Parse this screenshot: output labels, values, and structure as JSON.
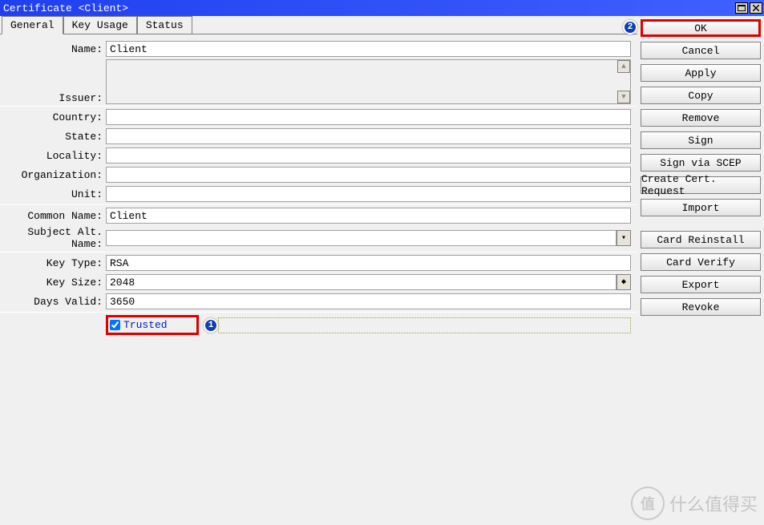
{
  "window": {
    "title": "Certificate <Client>"
  },
  "tabs": {
    "general": "General",
    "key_usage": "Key Usage",
    "status": "Status"
  },
  "labels": {
    "name": "Name:",
    "issuer": "Issuer:",
    "country": "Country:",
    "state": "State:",
    "locality": "Locality:",
    "organization": "Organization:",
    "unit": "Unit:",
    "common_name": "Common Name:",
    "subject_alt_name": "Subject Alt. Name:",
    "key_type": "Key Type:",
    "key_size": "Key Size:",
    "days_valid": "Days Valid:"
  },
  "values": {
    "name": "Client",
    "issuer": "",
    "country": "",
    "state": "",
    "locality": "",
    "organization": "",
    "unit": "",
    "common_name": "Client",
    "subject_alt_name": "",
    "key_type": "RSA",
    "key_size": "2048",
    "days_valid": "3650"
  },
  "trusted": {
    "label": "Trusted",
    "checked": true
  },
  "buttons": {
    "ok": "OK",
    "cancel": "Cancel",
    "apply": "Apply",
    "copy": "Copy",
    "remove": "Remove",
    "sign": "Sign",
    "sign_scep": "Sign via SCEP",
    "create_req": "Create Cert. Request",
    "import": "Import",
    "card_reinstall": "Card Reinstall",
    "card_verify": "Card Verify",
    "export": "Export",
    "revoke": "Revoke"
  },
  "annotations": {
    "a1": "1",
    "a2": "2"
  },
  "watermark": {
    "icon": "值",
    "text": "什么值得买"
  }
}
